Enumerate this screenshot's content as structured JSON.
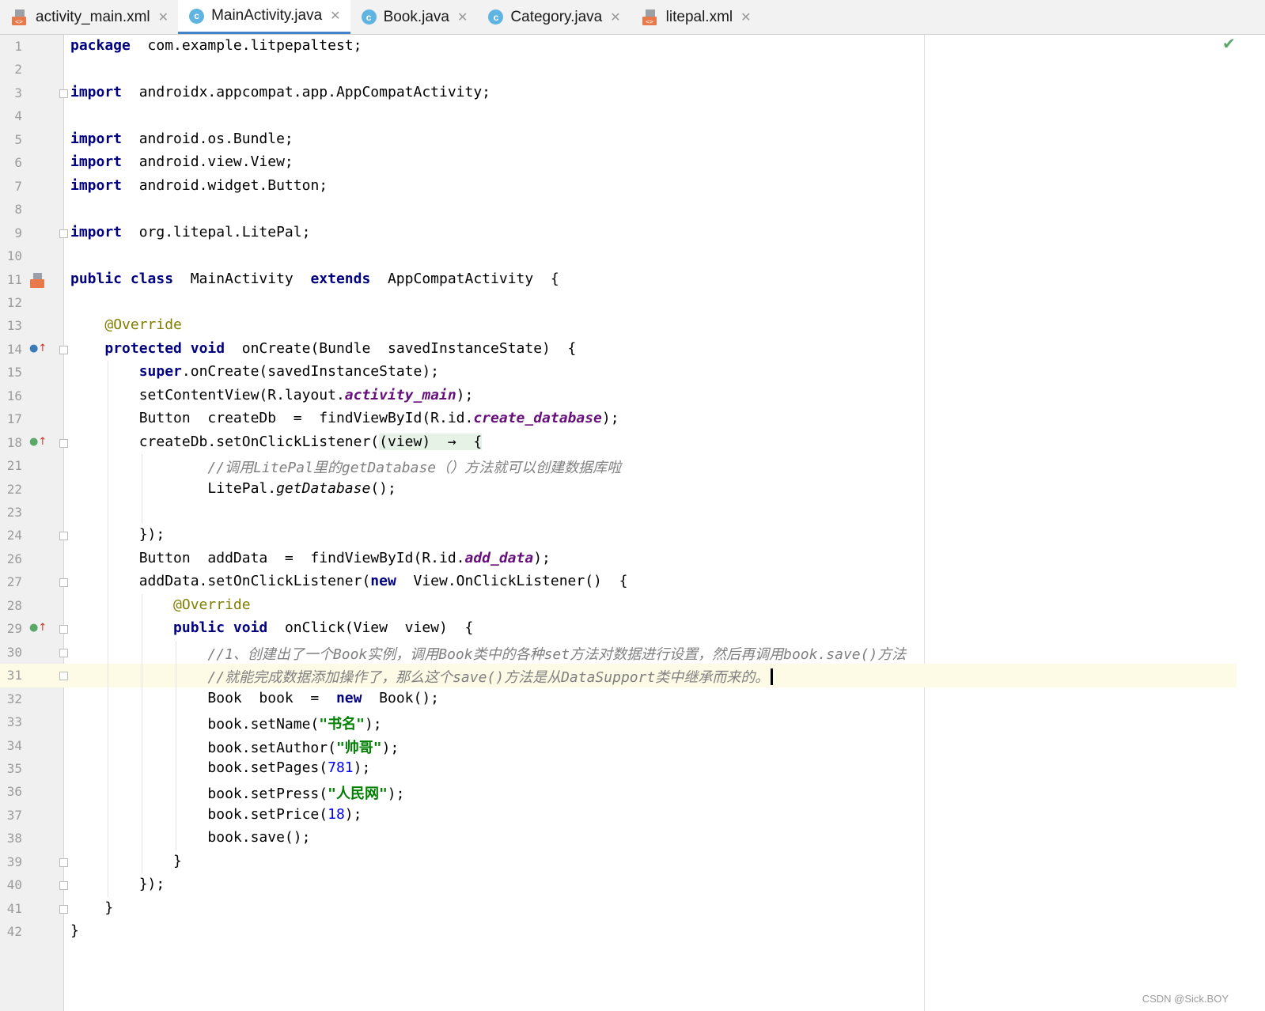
{
  "tabs": [
    {
      "label": "activity_main.xml",
      "type": "xml",
      "active": false
    },
    {
      "label": "MainActivity.java",
      "type": "java",
      "active": true
    },
    {
      "label": "Book.java",
      "type": "java",
      "active": false
    },
    {
      "label": "Category.java",
      "type": "java",
      "active": false
    },
    {
      "label": "litepal.xml",
      "type": "xml",
      "active": false
    }
  ],
  "editor": {
    "current_line": "31",
    "lines": [
      {
        "n": "1",
        "parts": [
          [
            "kw",
            "package"
          ],
          [
            "",
            "  com.example.litpepaltest;"
          ]
        ]
      },
      {
        "n": "2",
        "parts": []
      },
      {
        "n": "3",
        "parts": [
          [
            "kw",
            "import"
          ],
          [
            "",
            "  androidx.appcompat.app.AppCompatActivity;"
          ]
        ]
      },
      {
        "n": "4",
        "parts": []
      },
      {
        "n": "5",
        "parts": [
          [
            "kw",
            "import"
          ],
          [
            "",
            "  android.os.Bundle;"
          ]
        ]
      },
      {
        "n": "6",
        "parts": [
          [
            "kw",
            "import"
          ],
          [
            "",
            "  android.view.View;"
          ]
        ]
      },
      {
        "n": "7",
        "parts": [
          [
            "kw",
            "import"
          ],
          [
            "",
            "  android.widget.Button;"
          ]
        ]
      },
      {
        "n": "8",
        "parts": []
      },
      {
        "n": "9",
        "parts": [
          [
            "kw",
            "import"
          ],
          [
            "",
            "  org.litepal.LitePal;"
          ]
        ]
      },
      {
        "n": "10",
        "parts": []
      },
      {
        "n": "11",
        "parts": [
          [
            "kw",
            "public class"
          ],
          [
            "",
            "  MainActivity  "
          ],
          [
            "kw",
            "extends"
          ],
          [
            "",
            "  AppCompatActivity  {"
          ]
        ]
      },
      {
        "n": "12",
        "parts": []
      },
      {
        "n": "13",
        "parts": [
          [
            "",
            "    "
          ],
          [
            "ann",
            "@Override"
          ]
        ]
      },
      {
        "n": "14",
        "parts": [
          [
            "",
            "    "
          ],
          [
            "kw",
            "protected void"
          ],
          [
            "",
            "  onCreate(Bundle  savedInstanceState)  {"
          ]
        ]
      },
      {
        "n": "15",
        "parts": [
          [
            "",
            "        "
          ],
          [
            "kw",
            "super"
          ],
          [
            "",
            ".onCreate(savedInstanceState);"
          ]
        ]
      },
      {
        "n": "16",
        "parts": [
          [
            "",
            "        setContentView(R.layout."
          ],
          [
            "fld",
            "activity_main"
          ],
          [
            "",
            ");"
          ]
        ]
      },
      {
        "n": "17",
        "parts": [
          [
            "",
            "        Button  createDb  =  findViewById(R.id."
          ],
          [
            "fld",
            "create_database"
          ],
          [
            "",
            ");"
          ]
        ]
      },
      {
        "n": "18",
        "parts": [
          [
            "",
            "        createDb.setOnClickListener("
          ],
          [
            "lam",
            "(view)  →  {"
          ]
        ]
      },
      {
        "n": "21",
        "parts": [
          [
            "",
            "                "
          ],
          [
            "cmt",
            "//调用LitePal里的getDatabase（）方法就可以创建数据库啦"
          ]
        ]
      },
      {
        "n": "22",
        "parts": [
          [
            "",
            "                LitePal."
          ],
          [
            "mth",
            "getDatabase"
          ],
          [
            "",
            "();"
          ]
        ]
      },
      {
        "n": "23",
        "parts": []
      },
      {
        "n": "24",
        "parts": [
          [
            "",
            "        });"
          ]
        ]
      },
      {
        "n": "26",
        "parts": [
          [
            "",
            "        Button  addData  =  findViewById(R.id."
          ],
          [
            "fld",
            "add_data"
          ],
          [
            "",
            ");"
          ]
        ]
      },
      {
        "n": "27",
        "parts": [
          [
            "",
            "        addData.setOnClickListener("
          ],
          [
            "kw",
            "new"
          ],
          [
            "",
            "  View.OnClickListener()  {"
          ]
        ]
      },
      {
        "n": "28",
        "parts": [
          [
            "",
            "            "
          ],
          [
            "ann",
            "@Override"
          ]
        ]
      },
      {
        "n": "29",
        "parts": [
          [
            "",
            "            "
          ],
          [
            "kw",
            "public void"
          ],
          [
            "",
            "  onClick(View  view)  {"
          ]
        ]
      },
      {
        "n": "30",
        "parts": [
          [
            "",
            "                "
          ],
          [
            "cmt",
            "//1、创建出了一个Book实例，调用Book类中的各种set方法对数据进行设置，然后再调用book.save()方法"
          ]
        ]
      },
      {
        "n": "31",
        "parts": [
          [
            "",
            "                "
          ],
          [
            "cmt",
            "//就能完成数据添加操作了，那么这个save()方法是从DataSupport类中继承而来的。"
          ]
        ]
      },
      {
        "n": "32",
        "parts": [
          [
            "",
            "                Book  book  =  "
          ],
          [
            "kw",
            "new"
          ],
          [
            "",
            "  Book();"
          ]
        ]
      },
      {
        "n": "33",
        "parts": [
          [
            "",
            "                book.setName("
          ],
          [
            "str",
            "\"书名\""
          ],
          [
            "",
            ");"
          ]
        ]
      },
      {
        "n": "34",
        "parts": [
          [
            "",
            "                book.setAuthor("
          ],
          [
            "str",
            "\"帅哥\""
          ],
          [
            "",
            ");"
          ]
        ]
      },
      {
        "n": "35",
        "parts": [
          [
            "",
            "                book.setPages("
          ],
          [
            "num",
            "781"
          ],
          [
            "",
            ");"
          ]
        ]
      },
      {
        "n": "36",
        "parts": [
          [
            "",
            "                book.setPress("
          ],
          [
            "str",
            "\"人民网\""
          ],
          [
            "",
            ");"
          ]
        ]
      },
      {
        "n": "37",
        "parts": [
          [
            "",
            "                book.setPrice("
          ],
          [
            "num",
            "18"
          ],
          [
            "",
            ");"
          ]
        ]
      },
      {
        "n": "38",
        "parts": [
          [
            "",
            "                book.save();"
          ]
        ]
      },
      {
        "n": "39",
        "parts": [
          [
            "",
            "            }"
          ]
        ]
      },
      {
        "n": "40",
        "parts": [
          [
            "",
            "        });"
          ]
        ]
      },
      {
        "n": "41",
        "parts": [
          [
            "",
            "    }"
          ]
        ]
      },
      {
        "n": "42",
        "parts": [
          [
            "",
            "}"
          ]
        ]
      }
    ]
  },
  "status": {
    "inspection": "no problems"
  },
  "watermark": "CSDN @Sick.BOY"
}
